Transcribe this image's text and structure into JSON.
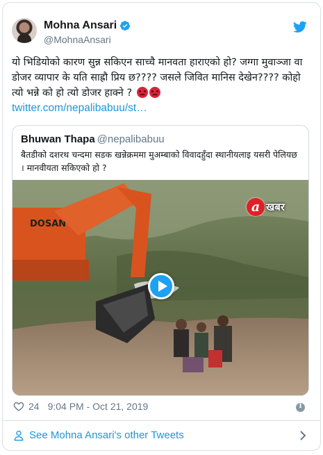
{
  "author": {
    "display_name": "Mohna Ansari",
    "handle": "@MohnaAnsari",
    "verified": true
  },
  "tweet": {
    "text": "यो भिडियोको कारण सुन्न सकिएन साच्चै मानवता हाराएको हो?  जग्गा मुवाञ्जा वा डोजर व्यापार के यति साह्रौ प्रिय छ???? जसले जिवित मानिस देखेन???? कोहो त्यो भन्ने को हो त्यो डोजर हाक्ने ? ",
    "link": "twitter.com/nepalibabuu/st…"
  },
  "quoted_tweet": {
    "display_name": "Bhuwan Thapa",
    "handle": "@nepalibabuu",
    "text": "बैतडीको दशरथ चन्दमा सडक खन्नेक्रममा मुअम्बाको विवादहुँदा स्थानीयलाइ यसरी पेलियछ । मानवीयता सकिएको हो ?",
    "video": {
      "logo_letter": "a",
      "logo_text": "खबर",
      "machine_text": "DOSAN"
    }
  },
  "meta": {
    "likes": "24",
    "timestamp": "9:04 PM - Oct 21, 2019"
  },
  "footer": {
    "link_text": "See Mohna Ansari's other Tweets"
  },
  "colors": {
    "accent": "#1da1f2",
    "link": "#1b95e0",
    "muted": "#657786",
    "border": "#d9dee3"
  }
}
